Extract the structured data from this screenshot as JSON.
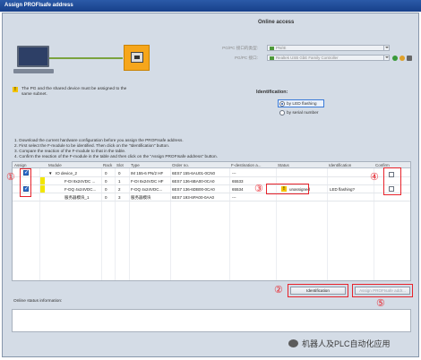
{
  "window": {
    "title": "Assign PROFIsafe address"
  },
  "online_access": {
    "title": "Online access",
    "pgpc_type_label": "PG/PC 接口的类型:",
    "pgpc_type_value": "PN/IE",
    "pgpc_if_label": "PG/PC 接口:",
    "pgpc_if_value": "Realtek USB GbE Family Controller",
    "note": "The PG and the shared device must be assigned to the same subnet."
  },
  "identification": {
    "title": "Identification:",
    "options": [
      "by LED flashing",
      "by serial number"
    ],
    "selected": "by LED flashing"
  },
  "steps": [
    "1. Download the current hardware configuration before you assign the PROFIsafe address.",
    "2. First select the F-module to be identified. Then click on the \"Identification\" button.",
    "3. Compare the reaction of the F-module to that in the table.",
    "4. Confirm the reaction of the F-module in the table and then click on the \"Assign PROFIsafe address\" button."
  ],
  "table": {
    "headers": {
      "assign": "Assign",
      "module": "Module",
      "rack": "Rack",
      "slot": "Slot",
      "type": "Type",
      "order_no": "Order no.",
      "f_dest": "F-destination a...",
      "status": "Status",
      "identification": "Identification",
      "confirm": "Confirm"
    },
    "rows": [
      {
        "module": "IO device_2",
        "rack": "0",
        "slot": "0",
        "type": "IM 155-6 PN/2 HF",
        "order_no": "6ES7 155-6AU01-0CN0",
        "f_dest": "---",
        "status": "",
        "identification": ""
      },
      {
        "module": "F-DI 8x24VDC ...",
        "rack": "0",
        "slot": "1",
        "type": "F-DI 8x24VDC HF",
        "order_no": "6ES7 136-6BA00-0CA0",
        "f_dest": "65533",
        "status": "",
        "identification": ""
      },
      {
        "module": "F-DQ 4x24VDC...",
        "rack": "0",
        "slot": "2",
        "type": "F-DQ 4x24VDC...",
        "order_no": "6ES7 136-6DB00-0CA0",
        "f_dest": "65534",
        "status": "unassigned",
        "identification": "LED flashing?"
      },
      {
        "module": "服务器模块_1",
        "rack": "0",
        "slot": "3",
        "type": "服务器模块",
        "order_no": "6ES7 193-6PA00-0AA0",
        "f_dest": "---",
        "status": "",
        "identification": ""
      }
    ]
  },
  "buttons": {
    "identification": "Identification",
    "assign": "Assign PROFIsafe addr..."
  },
  "status": {
    "label": "Online status information:"
  },
  "annotations": [
    "①",
    "②",
    "③",
    "④",
    "⑤"
  ],
  "watermark": "机器人及PLC自动化应用"
}
